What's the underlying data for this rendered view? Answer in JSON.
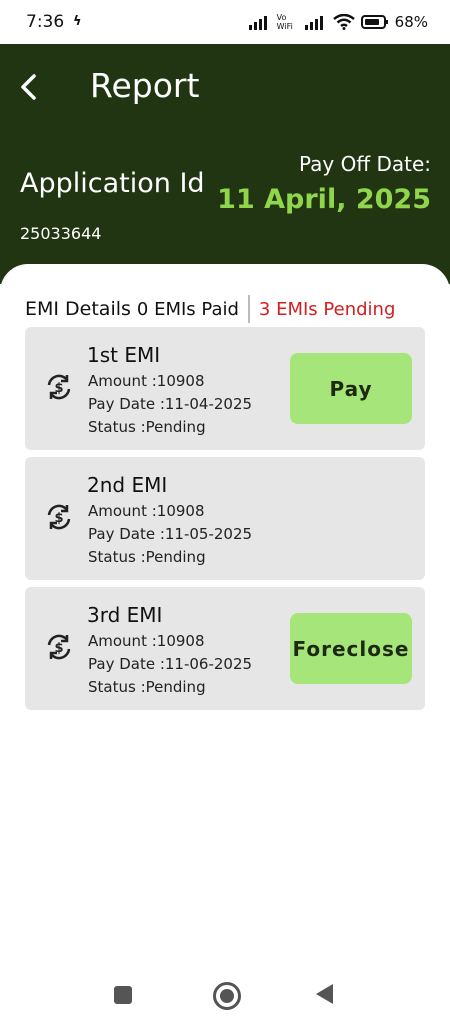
{
  "status_bar": {
    "time": "7:36",
    "network_label": "Vo WiFi",
    "battery": "68%"
  },
  "header": {
    "title": "Report",
    "application_id_label": "Application Id",
    "application_id": "25033644",
    "payoff_label": "Pay Off Date:",
    "payoff_date": "11 April, 2025",
    "payoff_color": "#8fd64c",
    "background_color": "#213512"
  },
  "summary": {
    "label": "EMI Details",
    "paid": "0 EMIs Paid",
    "pending": "3 EMIs Pending",
    "pending_color": "#d21f1f"
  },
  "emis": [
    {
      "title": "1st EMI",
      "amount_label": "Amount :",
      "amount": "10908",
      "date_label": "Pay Date :",
      "date": "11-04-2025",
      "status_label": "Status :",
      "status": "Pending",
      "action": "Pay"
    },
    {
      "title": "2nd EMI",
      "amount_label": "Amount :",
      "amount": "10908",
      "date_label": "Pay Date :",
      "date": "11-05-2025",
      "status_label": "Status :",
      "status": "Pending"
    },
    {
      "title": "3rd EMI",
      "amount_label": "Amount :",
      "amount": "10908",
      "date_label": "Pay Date :",
      "date": "11-06-2025",
      "status_label": "Status :",
      "status": "Pending",
      "action": "Foreclose"
    }
  ],
  "button_color": "#a6e57a",
  "icons": {
    "back": "arrow-left-icon",
    "emi": "currency-refresh-icon",
    "nav_recents": "square-icon",
    "nav_home": "circle-icon",
    "nav_back": "triangle-back-icon"
  }
}
